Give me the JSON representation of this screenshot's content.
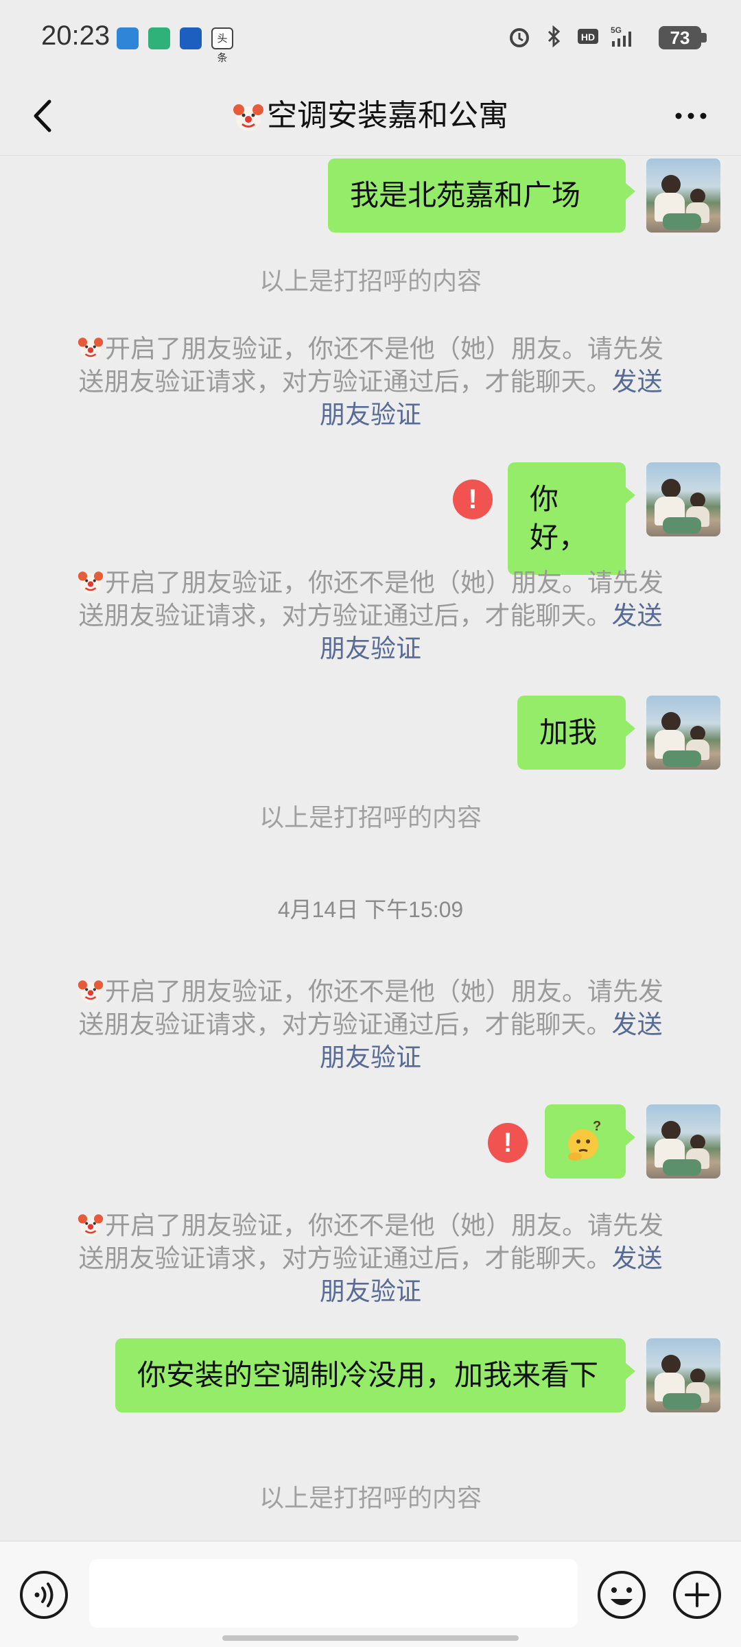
{
  "status_bar": {
    "time": "20:23",
    "apps": [
      "app-a",
      "app-b",
      "app-c",
      "头条"
    ],
    "network": "5G",
    "battery": "73"
  },
  "header": {
    "title": "空调安装嘉和公寓",
    "back_icon": "chevron-left-icon",
    "more_icon": "more-dots-icon"
  },
  "messages": {
    "m1": {
      "text": "我是北苑嘉和广场"
    },
    "greet1": "以上是打招呼的内容",
    "sys1": {
      "text": "开启了朋友验证，你还不是他（她）朋友。请先发送朋友验证请求，对方验证通过后，才能聊天。",
      "link": "发送朋友验证"
    },
    "m2": {
      "text": "你好，",
      "failed": true
    },
    "sys2": {
      "text": "开启了朋友验证，你还不是他（她）朋友。请先发送朋友验证请求，对方验证通过后，才能聊天。",
      "link": "发送朋友验证"
    },
    "m3": {
      "text": "加我"
    },
    "greet2": "以上是打招呼的内容",
    "timestamp": "4月14日 下午15:09",
    "sys3": {
      "text": "开启了朋友验证，你还不是他（她）朋友。请先发送朋友验证请求，对方验证通过后，才能聊天。",
      "link": "发送朋友验证"
    },
    "m4": {
      "sticker": "thinking-face-sticker",
      "failed": true
    },
    "sys4": {
      "text": "开启了朋友验证，你还不是他（她）朋友。请先发送朋友验证请求，对方验证通过后，才能聊天。",
      "link": "发送朋友验证"
    },
    "m5": {
      "text": "你安装的空调制冷没用，加我来看下"
    },
    "greet3": "以上是打招呼的内容"
  },
  "input_bar": {
    "voice_icon": "voice-icon",
    "emoji_icon": "emoji-icon",
    "plus_icon": "plus-icon"
  },
  "colors": {
    "bubble": "#95ec69",
    "background": "#ededed",
    "link": "#576b95",
    "error": "#f05350"
  }
}
